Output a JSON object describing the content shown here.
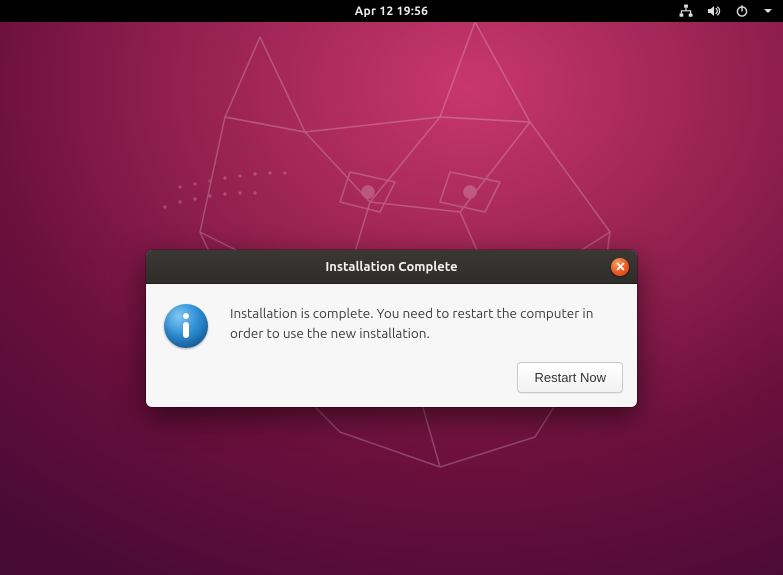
{
  "topbar": {
    "datetime": "Apr 12  19:56"
  },
  "dialog": {
    "title": "Installation Complete",
    "message": "Installation is complete. You need to restart the computer in order to use the new installation.",
    "restart_label": "Restart Now"
  }
}
